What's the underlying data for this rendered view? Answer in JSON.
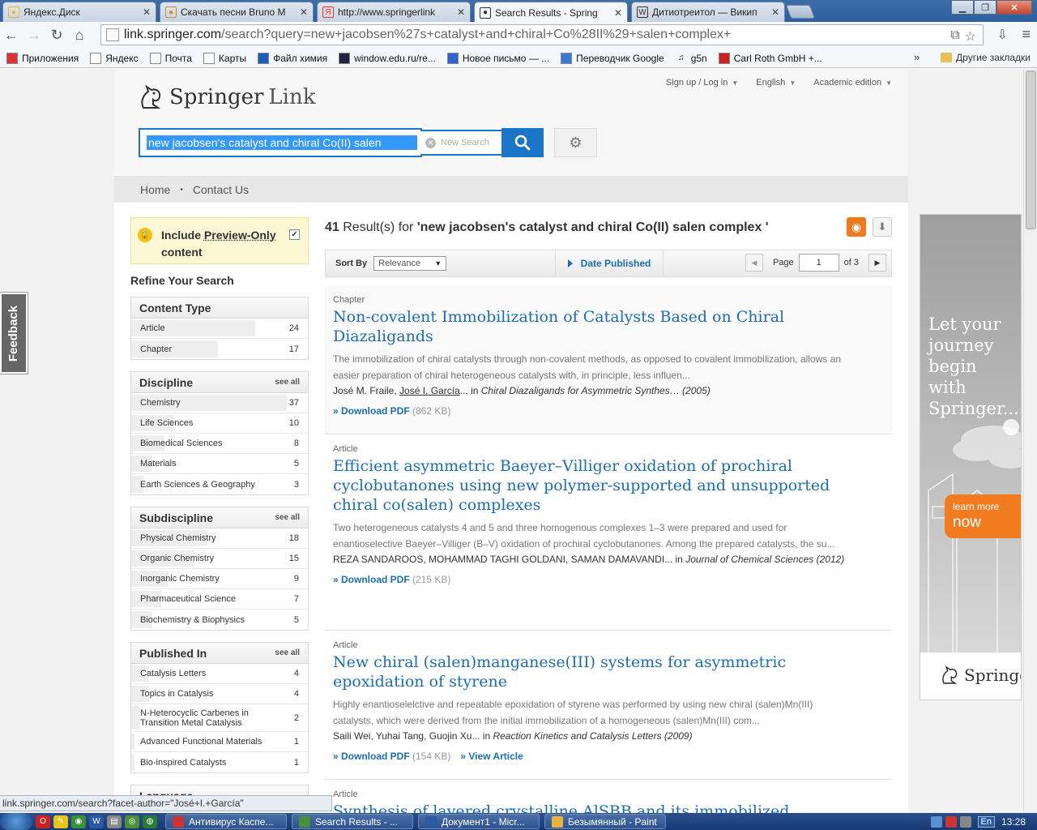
{
  "browser": {
    "tabs": [
      {
        "title": "Яндекс.Диск",
        "icon": "yandex-disk-icon",
        "color": "#e8b422"
      },
      {
        "title": "Скачать песни Bruno M",
        "icon": "music-site-icon",
        "color": "#d28b2a"
      },
      {
        "title": "http://www.springerlink",
        "icon": "yandex-y-icon",
        "color": "#e33"
      },
      {
        "title": "Search Results - Spring",
        "icon": "springer-icon",
        "color": "#333",
        "active": true
      },
      {
        "title": "Дитиотреитол — Викип",
        "icon": "wikipedia-w-icon",
        "color": "#333"
      }
    ],
    "url_host": "link.springer.com",
    "url_path": "/search?query=new+jacobsen%27s+catalyst+and+chiral+Co%28II%29+salen+complex+",
    "bookmarks": [
      {
        "label": "Приложения",
        "icon": "apps-grid-icon"
      },
      {
        "label": "Яндекс",
        "icon": "page-icon"
      },
      {
        "label": "Почта",
        "icon": "page-icon"
      },
      {
        "label": "Карты",
        "icon": "page-icon"
      },
      {
        "label": "Файл химия",
        "icon": "help-icon"
      },
      {
        "label": "window.edu.ru/re...",
        "icon": "window-edu-icon"
      },
      {
        "label": "Новое письмо — ...",
        "icon": "mail-icon"
      },
      {
        "label": "Переводчик Google",
        "icon": "translate-icon"
      },
      {
        "label": "g5n",
        "icon": "music-note-icon"
      },
      {
        "label": "Carl Roth GmbH +...",
        "icon": "roth-icon"
      }
    ],
    "bookmarks_overflow": "»",
    "other_bookmarks": "Другие закладки",
    "status_url": "link.springer.com/search?facet-author=\"José+I.+García\""
  },
  "header": {
    "logo_main": "Springer",
    "logo_sub": "Link",
    "links": [
      "Sign up / Log in",
      "English",
      "Academic edition"
    ],
    "search_value": "new jacobsen's catalyst and chiral Co(II) salen",
    "new_search": "New Search"
  },
  "subnav": {
    "home": "Home",
    "contact": "Contact Us",
    "sep": "•"
  },
  "feedback": "Feedback",
  "sidebar": {
    "preview_line1_a": "Include ",
    "preview_line1_b": "Preview-Only",
    "preview_line2": "content",
    "refine": "Refine Your Search",
    "see_all": "see all",
    "facets": [
      {
        "title": "Content Type",
        "see_all": false,
        "items": [
          {
            "label": "Article",
            "count": "24",
            "fill": 0.7
          },
          {
            "label": "Chapter",
            "count": "17",
            "fill": 0.49
          }
        ]
      },
      {
        "title": "Discipline",
        "see_all": true,
        "items": [
          {
            "label": "Chemistry",
            "count": "37",
            "fill": 0.88
          },
          {
            "label": "Life Sciences",
            "count": "10",
            "fill": 0.24
          },
          {
            "label": "Biomedical Sciences",
            "count": "8",
            "fill": 0.19
          },
          {
            "label": "Materials",
            "count": "5",
            "fill": 0.12
          },
          {
            "label": "Earth Sciences & Geography",
            "count": "3",
            "fill": 0.07
          }
        ]
      },
      {
        "title": "Subdiscipline",
        "see_all": true,
        "items": [
          {
            "label": "Physical Chemistry",
            "count": "18",
            "fill": 0.43
          },
          {
            "label": "Organic Chemistry",
            "count": "15",
            "fill": 0.36
          },
          {
            "label": "Inorganic Chemistry",
            "count": "9",
            "fill": 0.21
          },
          {
            "label": "Pharmaceutical Science",
            "count": "7",
            "fill": 0.17
          },
          {
            "label": "Biochemistry & Biophysics",
            "count": "5",
            "fill": 0.12
          }
        ]
      },
      {
        "title": "Published In",
        "see_all": true,
        "items": [
          {
            "label": "Catalysis Letters",
            "count": "4",
            "fill": 0.1
          },
          {
            "label": "Topics in Catalysis",
            "count": "4",
            "fill": 0.1
          },
          {
            "label": "N-Heterocyclic Carbenes in Transition Metal Catalysis",
            "count": "2",
            "fill": 0.05,
            "tall": true
          },
          {
            "label": "Advanced Functional Materials",
            "count": "1",
            "fill": 0.02
          },
          {
            "label": "Bio-inspired Catalysts",
            "count": "1",
            "fill": 0.02
          }
        ]
      },
      {
        "title": "Language",
        "see_all": false,
        "items": []
      }
    ]
  },
  "results": {
    "count": "41",
    "label": " Result(s) for ",
    "query": "'new jacobsen's catalyst and chiral Co(II) salen complex '",
    "sort_label": "Sort By",
    "sort_value": "Relevance",
    "date_published": "Date Published",
    "page_label": "Page",
    "page_value": "1",
    "page_of": "of 3",
    "items": [
      {
        "type": "Chapter",
        "title": "Non-covalent Immobilization of Catalysts Based on Chiral Diazaligands",
        "snippet": "The immobilization of chiral catalysts through non-covalent methods, as opposed to covalent immobilization, allows an easier preparation of chiral heterogeneous catalysts with, in principle, less influen...",
        "authors_a": "José M. Fraile, ",
        "authors_u": "José I. García",
        "authors_b": "... in ",
        "source": "Chiral Diazaligands for Asymmetric Synthes… (2005)",
        "download": "» Download PDF",
        "size": " (862 KB)",
        "view": ""
      },
      {
        "type": "Article",
        "title": "Efficient asymmetric Baeyer–Villiger oxidation of prochiral cyclobutanones using new polymer-supported and unsupported chiral co(salen) complexes",
        "snippet": "Two heterogeneous catalysts 4 and 5 and three homogenous complexes 1–3 were prepared and used for enantioselective Baeyer–Villiger (B–V) oxidation of prochiral cyclobutanones. Among the prepared catalysts, the su...",
        "authors_a": "REZA SANDAROOS, MOHAMMAD TAGHI GOLDANI, SAMAN DAMAVANDI",
        "authors_u": "",
        "authors_b": "... in ",
        "source": "Journal of Chemical Sciences (2012)",
        "download": "» Download PDF",
        "size": " (215 KB)",
        "view": ""
      },
      {
        "type": "Article",
        "title": "New chiral (salen)manganese(III) systems for asymmetric epoxidation of styrene",
        "snippet": "Highly enantioselelctive and repeatable epoxidation of styrene was performed by using new chiral (salen)Mn(III) catalysts, which were derived from the initial immobilization of a homogeneous (salen)Mn(III) com...",
        "authors_a": "Saili Wei, Yuhai Tang, Guojin Xu",
        "authors_u": "",
        "authors_b": "... in ",
        "source": "Reaction Kinetics and Catalysis Letters (2009)",
        "download": "» Download PDF",
        "size": " (154 KB)",
        "view": "» View Article"
      },
      {
        "type": "Article",
        "title": "Synthesis of layered crystalline AlSBB and its immobilized chiral",
        "snippet": "",
        "authors_a": "",
        "authors_u": "",
        "authors_b": "",
        "source": "",
        "download": "",
        "size": "",
        "view": ""
      }
    ]
  },
  "ad": {
    "headline": "Let your journey begin with Springer...",
    "learn_small": "learn more",
    "learn_big": "now",
    "logo": "Springer"
  },
  "taskbar": {
    "tasks": [
      {
        "label": "Антивирус Каспе...",
        "icon": "kaspersky-icon",
        "color": "#c33"
      },
      {
        "label": "Search Results - ...",
        "icon": "chrome-icon",
        "color": "#4a8f3c"
      },
      {
        "label": "Документ1 - Micr...",
        "icon": "word-icon",
        "color": "#2b5aa5"
      },
      {
        "label": "Безымянный - Paint",
        "icon": "paint-icon",
        "color": "#e9b43c"
      }
    ],
    "lang": "En",
    "clock": "13:28"
  }
}
